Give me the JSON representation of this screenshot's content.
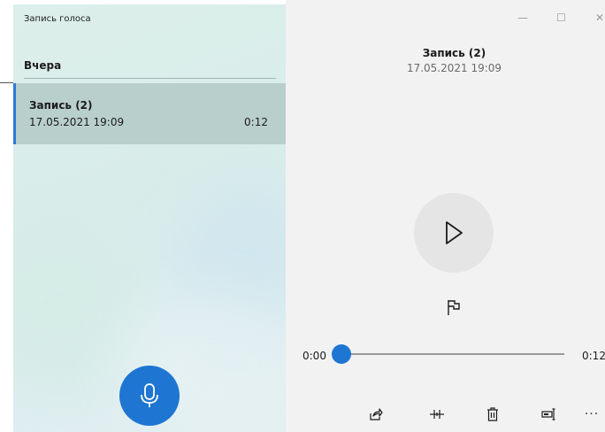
{
  "app": {
    "title": "Запись голоса"
  },
  "list": {
    "section_header": "Вчера",
    "items": [
      {
        "name": "Запись (2)",
        "date": "17.05.2021 19:09",
        "duration": "0:12",
        "selected": true
      }
    ]
  },
  "window_controls": {
    "minimize": "—",
    "maximize": "☐",
    "close": "✕"
  },
  "detail": {
    "title": "Запись (2)",
    "date": "17.05.2021 19:09",
    "position": "0:00",
    "length": "0:12",
    "progress": 0.0
  },
  "icons": {
    "record": "microphone-icon",
    "play": "play-icon",
    "marker": "flag-icon",
    "share": "share-icon",
    "trim": "trim-icon",
    "delete": "delete-icon",
    "rename": "rename-icon",
    "more": "more-icon"
  },
  "toolbar": {
    "more_label": "···"
  },
  "colors": {
    "accent": "#1e76d2",
    "selected_item": "#b9cfcc",
    "right_pane": "#f2f2f2"
  }
}
